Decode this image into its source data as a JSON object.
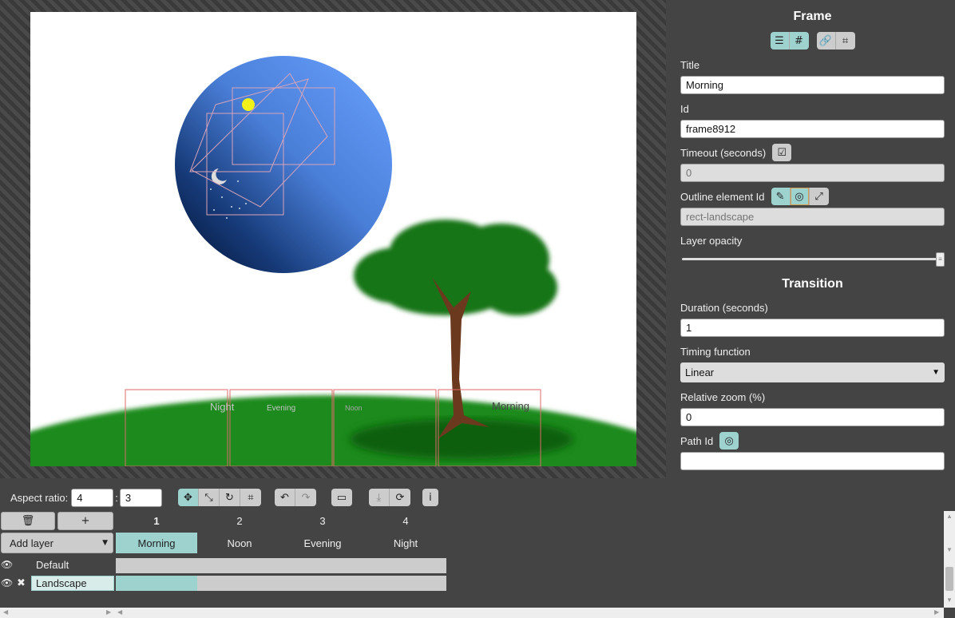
{
  "canvas": {
    "frame_labels": [
      "Night",
      "Evening",
      "Noon",
      "Morning"
    ]
  },
  "frame_panel": {
    "heading": "Frame",
    "title_label": "Title",
    "title_value": "Morning",
    "id_label": "Id",
    "id_value": "frame8912",
    "timeout_label": "Timeout (seconds)",
    "timeout_placeholder": "0",
    "outline_label": "Outline element Id",
    "outline_placeholder": "rect-landscape",
    "opacity_label": "Layer opacity",
    "opacity_value": 1.0
  },
  "transition_panel": {
    "heading": "Transition",
    "duration_label": "Duration (seconds)",
    "duration_value": "1",
    "timing_label": "Timing function",
    "timing_value": "Linear",
    "zoom_label": "Relative zoom (%)",
    "zoom_value": "0",
    "path_label": "Path Id",
    "path_value": ""
  },
  "toolbar": {
    "aspect_label": "Aspect ratio:",
    "aspect_w": "4",
    "aspect_sep": ":",
    "aspect_h": "3"
  },
  "timeline": {
    "add_layer": "Add layer",
    "frame_numbers": [
      "1",
      "2",
      "3",
      "4"
    ],
    "frame_titles": [
      "Morning",
      "Noon",
      "Evening",
      "Night"
    ],
    "layers": [
      {
        "name": "Default"
      },
      {
        "name": "Landscape"
      }
    ]
  },
  "colors": {
    "accent": "#9dd2cf",
    "panel": "#444444",
    "grass": "#1a8a1a",
    "sky": "#5b8fe6"
  }
}
